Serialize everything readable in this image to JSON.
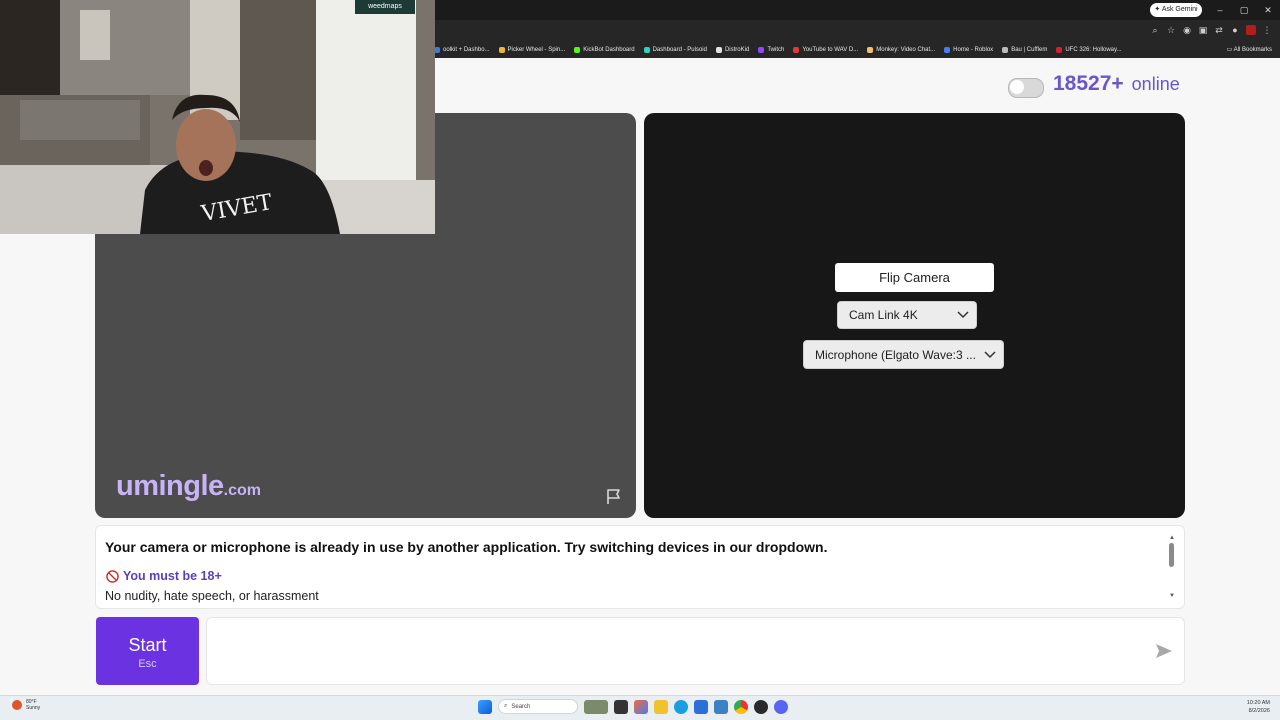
{
  "browser": {
    "gemini_label": "Ask Gemini",
    "window_controls": [
      "–",
      "▢",
      "✕"
    ],
    "bookmarks": [
      {
        "label": "oolkit + Dashbo...",
        "color": "#3a7be0"
      },
      {
        "label": "Picker Wheel - Spin...",
        "color": "#f2b531"
      },
      {
        "label": "KickBot Dashboard",
        "color": "#53fc18"
      },
      {
        "label": "Dashboard - Pulsoid",
        "color": "#2bd4c0"
      },
      {
        "label": "DistroKid",
        "color": "#e2e2e2"
      },
      {
        "label": "Twitch",
        "color": "#9146ff"
      },
      {
        "label": "YouTube to WAV D...",
        "color": "#e53935"
      },
      {
        "label": "Monkey: Video Chat...",
        "color": "#f5c06b"
      },
      {
        "label": "Home - Roblox",
        "color": "#4a7cf0"
      },
      {
        "label": "Bau | Cufflem",
        "color": "#bbbbbb"
      },
      {
        "label": "UFC 326: Holloway...",
        "color": "#d3202e"
      }
    ],
    "all_bookmarks_label": "All Bookmarks"
  },
  "header": {
    "online_count": "18527+",
    "online_label": "online",
    "toggle_on": false
  },
  "left_panel": {
    "brand_name": "umingle",
    "brand_tld": ".com"
  },
  "right_panel": {
    "flip_camera_label": "Flip Camera",
    "camera_select_value": "Cam Link 4K",
    "microphone_select_value": "Microphone (Elgato Wave:3 ..."
  },
  "messages": {
    "error": "Your camera or microphone is already in use by another application. Try switching devices in our dropdown.",
    "age_notice": "You must be 18+",
    "rules": "No nudity, hate speech, or harassment"
  },
  "controls": {
    "start_label": "Start",
    "start_shortcut": "Esc",
    "chat_value": ""
  },
  "webcam": {
    "shirt_text": "VIVET",
    "sign_text": "weedmaps"
  },
  "taskbar": {
    "weather_temp": "80°F",
    "weather_condition": "Sunny",
    "weather_badge": "2",
    "search_placeholder": "Search",
    "time": "10:20 AM",
    "date": "8/2/2026"
  },
  "colors": {
    "accent": "#6b55c9",
    "start_button": "#6a32e0",
    "left_video_bg": "#4c4c4c",
    "right_video_bg": "#171717"
  }
}
